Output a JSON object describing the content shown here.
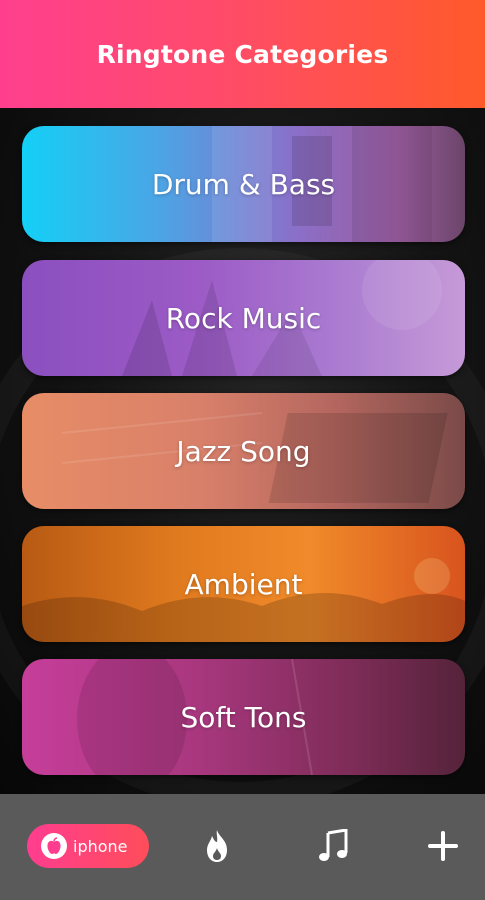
{
  "header": {
    "title": "Ringtone Categories"
  },
  "categories": [
    {
      "label": "Drum & Bass"
    },
    {
      "label": "Rock Music"
    },
    {
      "label": "Jazz Song"
    },
    {
      "label": "Ambient"
    },
    {
      "label": "Soft Tons"
    }
  ],
  "bottom_nav": {
    "iphone_label": "iphone",
    "icons": [
      "apple-icon",
      "fire-icon",
      "music-note-icon",
      "plus-icon"
    ]
  },
  "colors": {
    "header_start": "#ff3f8e",
    "header_end": "#ff5a2a",
    "nav_bar": "#5a5a5a",
    "active_pill": "#ff3d8f"
  }
}
